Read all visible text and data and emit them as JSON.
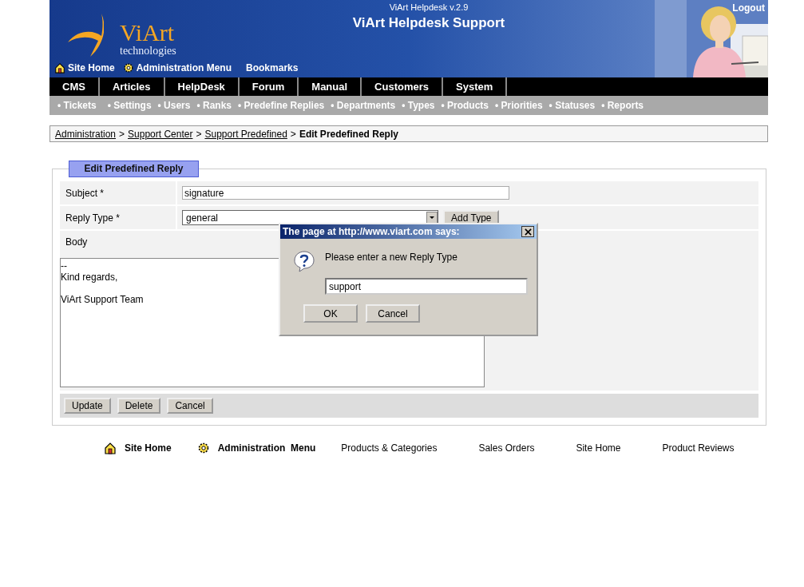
{
  "header": {
    "version": "ViArt Helpdesk v.2.9",
    "title": "ViArt Helpdesk Support",
    "logout": "Logout",
    "logo": {
      "name": "ViArt",
      "tagline": "technologies"
    },
    "links": [
      {
        "label": "Site Home",
        "kind": "home"
      },
      {
        "label": "Administration Menu",
        "kind": "admin"
      },
      {
        "label": "Bookmarks",
        "kind": "plain"
      }
    ]
  },
  "main_nav": [
    "CMS",
    "Articles",
    "HelpDesk",
    "Forum",
    "Manual",
    "Customers",
    "System"
  ],
  "sub_nav": [
    "• Tickets",
    "• Settings",
    "• Users",
    "• Ranks",
    "• Predefine Replies",
    "• Departments",
    "• Types",
    "• Products",
    "• Priorities",
    "• Statuses",
    "• Reports"
  ],
  "breadcrumb": {
    "separator": ">",
    "links": [
      "Administration",
      "Support Center",
      "Support Predefined"
    ],
    "current": "Edit Predefined Reply"
  },
  "form": {
    "title": "Edit Predefined Reply",
    "fields": [
      {
        "label": "Subject *",
        "kind": "text",
        "value": "signature"
      },
      {
        "label": "Reply Type *",
        "kind": "select",
        "value": "general",
        "button": "Add Type"
      }
    ],
    "body": {
      "label": "Body",
      "value": "--\nKind regards,\n\nViArt Support Team"
    },
    "buttons": [
      "Update",
      "Delete",
      "Cancel"
    ]
  },
  "dialog": {
    "title": "The page at http://www.viart.com says:",
    "message": "Please enter a new Reply Type",
    "value": "support",
    "buttons": [
      "OK",
      "Cancel"
    ]
  },
  "footer": [
    {
      "label": "Site Home",
      "kind": "home"
    },
    {
      "label": "Administration  Menu",
      "kind": "admin"
    },
    {
      "label": "Products & Categories",
      "kind": "plain"
    },
    {
      "label": "Sales Orders",
      "kind": "plain"
    },
    {
      "label": "Site Home",
      "kind": "plain"
    },
    {
      "label": "Product Reviews",
      "kind": "plain"
    }
  ]
}
